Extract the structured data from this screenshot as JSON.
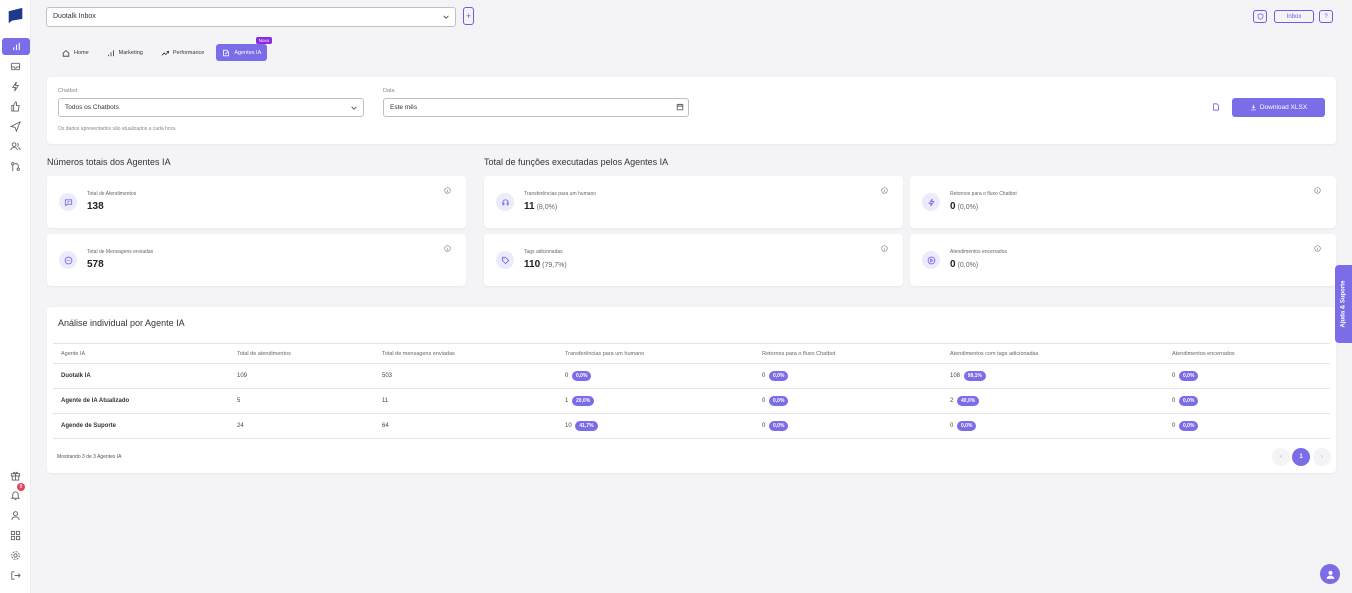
{
  "topbar": {
    "inbox_select": "Duotalk Inbox",
    "plus": "+",
    "inbox_button": "Inbox",
    "help_button": "?"
  },
  "tabs": [
    {
      "label": "Home"
    },
    {
      "label": "Marketing"
    },
    {
      "label": "Performance"
    },
    {
      "label": "Agentes IA",
      "badge": "Novo"
    }
  ],
  "sidebar": {
    "notification_count": "8"
  },
  "filters": {
    "chatbot_label": "Chatbot",
    "chatbot_value": "Todos os Chatbots",
    "date_label": "Data",
    "date_value": "Este mês",
    "note": "Os dados apresentados são atualizados a cada hora.",
    "download_label": "Download XLSX"
  },
  "sections": {
    "totals_title": "Números totais dos Agentes IA",
    "functions_title": "Total de funções executadas pelos Agentes IA",
    "analysis_title": "Análise individual por Agente IA"
  },
  "stats": [
    {
      "label": "Total de Atendimentos",
      "value": "138",
      "pct": "",
      "icon": "chat-icon"
    },
    {
      "label": "Total de Mensagens enviadas",
      "value": "578",
      "pct": "",
      "icon": "message-dots-icon"
    },
    {
      "label": "Transferências para um humano",
      "value": "11",
      "pct": "(8,0%)",
      "icon": "headset-icon"
    },
    {
      "label": "Retornos para o fluxo Chatbot",
      "value": "0",
      "pct": "(0,0%)",
      "icon": "bolt-icon"
    },
    {
      "label": "Tags adicionadas",
      "value": "110",
      "pct": "(79,7%)",
      "icon": "tag-icon"
    },
    {
      "label": "Atendimentos encerrados",
      "value": "0",
      "pct": "(0,0%)",
      "icon": "stop-icon"
    }
  ],
  "table": {
    "headers": [
      "Agente IA",
      "Total de atendimentos",
      "Total de mensagens enviadas",
      "Transferências para um humano",
      "Retornos para o fluxo Chatbot",
      "Atendimentos com tags adicionadas",
      "Atendimentos encerrados"
    ],
    "rows": [
      {
        "name": "Duotalk IA",
        "total": "109",
        "msgs": "503",
        "transf": "0",
        "transf_pct": "0,0%",
        "ret": "0",
        "ret_pct": "0,0%",
        "tags": "108",
        "tags_pct": "99,1%",
        "enc": "0",
        "enc_pct": "0,0%"
      },
      {
        "name": "Agente de IA Atualizado",
        "total": "5",
        "msgs": "11",
        "transf": "1",
        "transf_pct": "20,0%",
        "ret": "0",
        "ret_pct": "0,0%",
        "tags": "2",
        "tags_pct": "40,0%",
        "enc": "0",
        "enc_pct": "0,0%"
      },
      {
        "name": "Agende de Suporte",
        "total": "24",
        "msgs": "64",
        "transf": "10",
        "transf_pct": "41,7%",
        "ret": "0",
        "ret_pct": "0,0%",
        "tags": "0",
        "tags_pct": "0,0%",
        "enc": "0",
        "enc_pct": "0,0%"
      }
    ],
    "footer": "Mostrando 3 de 3 Agentes IA",
    "page": "1",
    "prev": "‹",
    "next": "›"
  },
  "help_tab": "Ajuda & Suporte",
  "colors": {
    "accent": "#7b6ce8",
    "badge": "#8a2be2"
  }
}
